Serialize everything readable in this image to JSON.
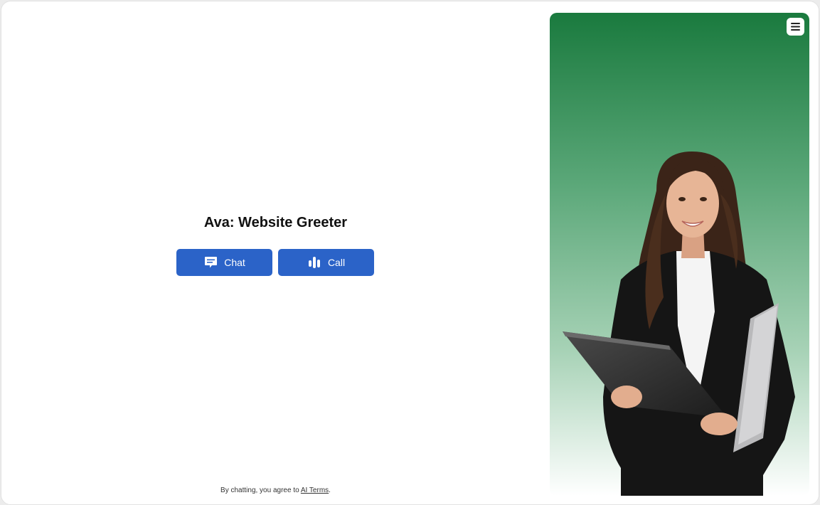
{
  "agent": {
    "title": "Ava: Website Greeter"
  },
  "actions": {
    "chat_label": "Chat",
    "call_label": "Call",
    "chat_icon": "chat-bubble-icon",
    "call_icon": "audio-bars-icon"
  },
  "footer": {
    "prefix": "By chatting, you agree to ",
    "terms_link": "AI Terms",
    "suffix": "."
  },
  "hero": {
    "image": "businesswoman-holding-tablet-and-laptop",
    "gradient_top": "#1a7a3e",
    "gradient_bottom": "#ffffff"
  },
  "menu": {
    "icon": "hamburger-menu-icon"
  },
  "colors": {
    "button": "#2b63c8",
    "title_text": "#111111"
  }
}
